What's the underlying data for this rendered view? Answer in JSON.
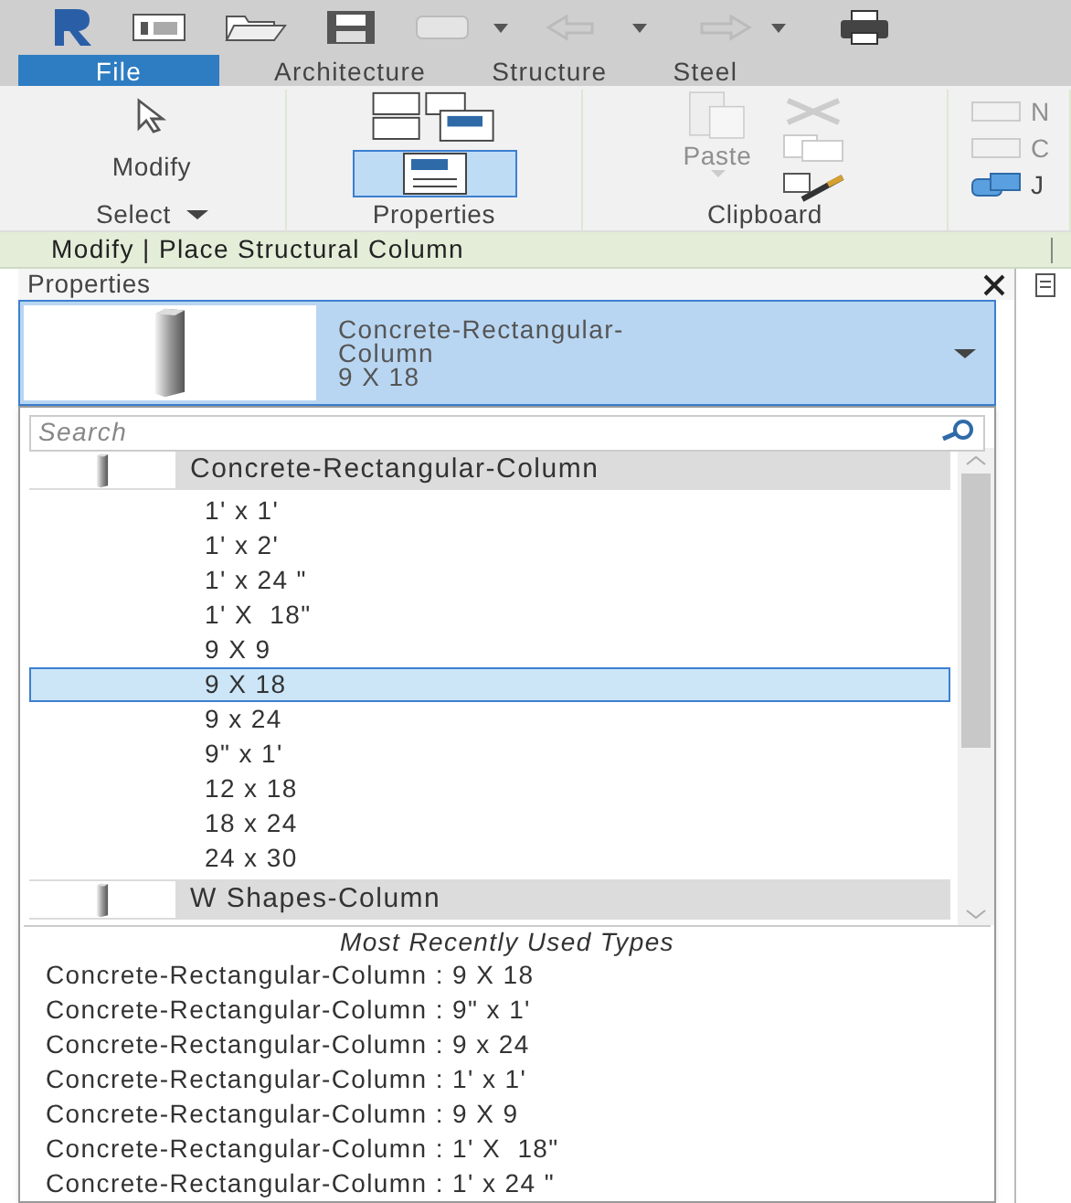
{
  "tabs": [
    {
      "label": "File",
      "selected": true
    },
    {
      "label": "Architecture",
      "selected": false
    },
    {
      "label": "Structure",
      "selected": false
    },
    {
      "label": "Steel",
      "selected": false
    }
  ],
  "ribbon": {
    "panels": [
      {
        "kind": "select",
        "title": "Select",
        "buttons": [
          {
            "label": "Modify",
            "disabled": false
          }
        ]
      },
      {
        "kind": "properties",
        "title": "Properties"
      },
      {
        "kind": "clipboard",
        "title": "Clipboard",
        "buttons": [
          {
            "label": "Paste",
            "disabled": true
          }
        ]
      },
      {
        "kind": "geometry",
        "buttons": [
          {
            "label": "N",
            "disabled": true
          },
          {
            "label": "C",
            "disabled": true
          },
          {
            "label": "J",
            "disabled": false
          }
        ]
      }
    ]
  },
  "context_bar": {
    "title": "Modify | Place Structural Column"
  },
  "properties": {
    "title": "Properties",
    "type_selector": {
      "family": "Concrete-Rectangular-Column",
      "type": "9 X 18"
    },
    "search": {
      "placeholder": "Search"
    },
    "families": [
      {
        "name": "Concrete-Rectangular-Column",
        "types": [
          {
            "label": "1' x 1'",
            "selected": false
          },
          {
            "label": "1' x 2'",
            "selected": false
          },
          {
            "label": "1' x 24 \"",
            "selected": false
          },
          {
            "label": "1' X  18\"",
            "selected": false
          },
          {
            "label": "9 X 9",
            "selected": false
          },
          {
            "label": "9 X 18",
            "selected": true
          },
          {
            "label": "9 x 24",
            "selected": false
          },
          {
            "label": "9\" x 1'",
            "selected": false
          },
          {
            "label": "12 x 18",
            "selected": false
          },
          {
            "label": "18 x 24",
            "selected": false
          },
          {
            "label": "24 x 30",
            "selected": false
          }
        ]
      },
      {
        "name": "W Shapes-Column"
      }
    ],
    "recent": {
      "title": "Most Recently Used Types",
      "items": [
        "Concrete-Rectangular-Column : 9 X 18",
        "Concrete-Rectangular-Column : 9\" x 1'",
        "Concrete-Rectangular-Column : 9 x 24",
        "Concrete-Rectangular-Column : 1' x 1'",
        "Concrete-Rectangular-Column : 9 X 9",
        "Concrete-Rectangular-Column : 1' X  18\"",
        "Concrete-Rectangular-Column : 1' x 24 \""
      ]
    }
  }
}
